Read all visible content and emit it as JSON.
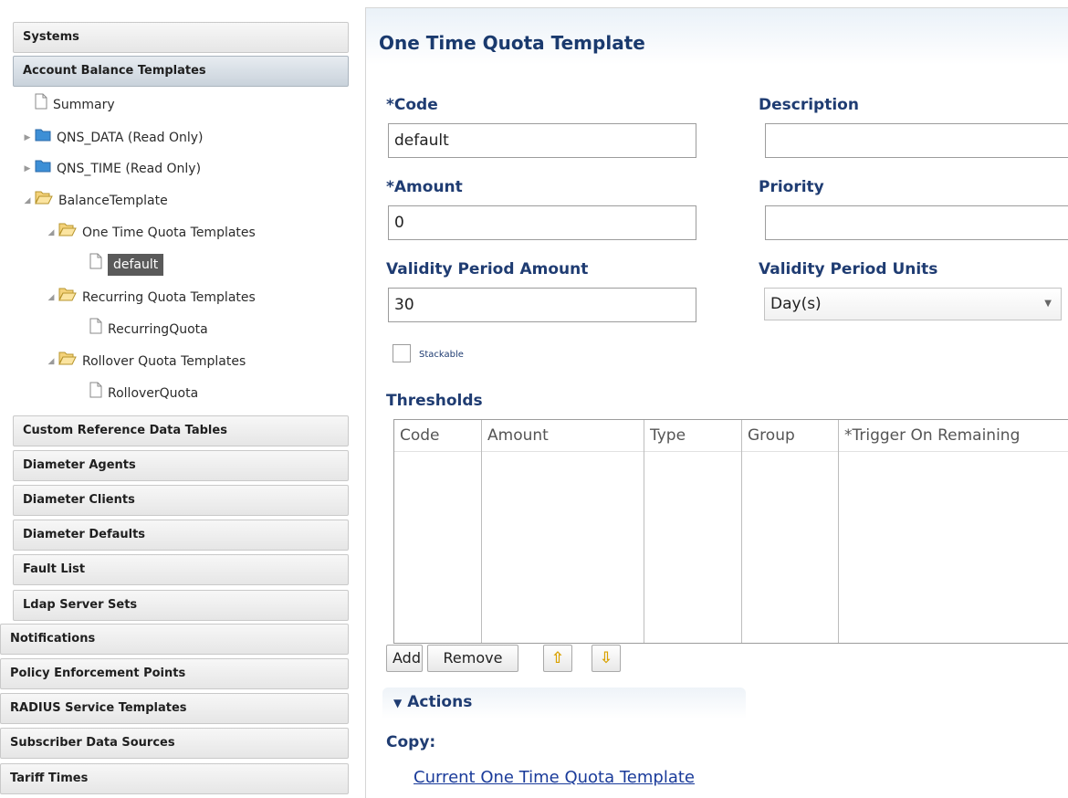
{
  "nav": {
    "systems": "Systems",
    "account_balance_templates": "Account Balance Templates",
    "tree": {
      "summary": "Summary",
      "qns_data": "QNS_DATA (Read Only)",
      "qns_time": "QNS_TIME (Read Only)",
      "balance_template": "BalanceTemplate",
      "one_time_quota_templates": "One Time Quota Templates",
      "default": "default",
      "recurring_quota_templates": "Recurring Quota Templates",
      "recurring_quota": "RecurringQuota",
      "rollover_quota_templates": "Rollover Quota Templates",
      "rollover_quota": "RolloverQuota"
    },
    "sections": [
      "Custom Reference Data Tables",
      "Diameter Agents",
      "Diameter Clients",
      "Diameter Defaults",
      "Fault List",
      "Ldap Server Sets",
      "Notifications",
      "Policy Enforcement Points",
      "RADIUS Service Templates",
      "Subscriber Data Sources",
      "Tariff Times"
    ]
  },
  "form": {
    "title": "One Time Quota Template",
    "code_label": "*Code",
    "code_value": "default",
    "description_label": "Description",
    "description_value": "",
    "amount_label": "*Amount",
    "amount_value": "0",
    "priority_label": "Priority",
    "priority_value": "",
    "validity_amount_label": "Validity Period Amount",
    "validity_amount_value": "30",
    "validity_units_label": "Validity Period Units",
    "validity_units_value": "Day(s)",
    "stackable_label": "Stackable",
    "stackable_checked": false,
    "thresholds_label": "Thresholds",
    "thresholds_columns": [
      "Code",
      "Amount",
      "Type",
      "Group",
      "*Trigger On Remaining"
    ],
    "thresholds_rows": [],
    "add_label": "Add",
    "remove_label": "Remove",
    "move_up_icon": "arrow-up-icon",
    "move_down_icon": "arrow-down-icon"
  },
  "actions": {
    "title": "Actions",
    "copy_label": "Copy:",
    "copy_link": "Current One Time Quota Template"
  },
  "colors": {
    "label_blue": "#1f3c72",
    "link_blue": "#1a3b9a",
    "selected_item_bg": "#5a5a5a"
  }
}
